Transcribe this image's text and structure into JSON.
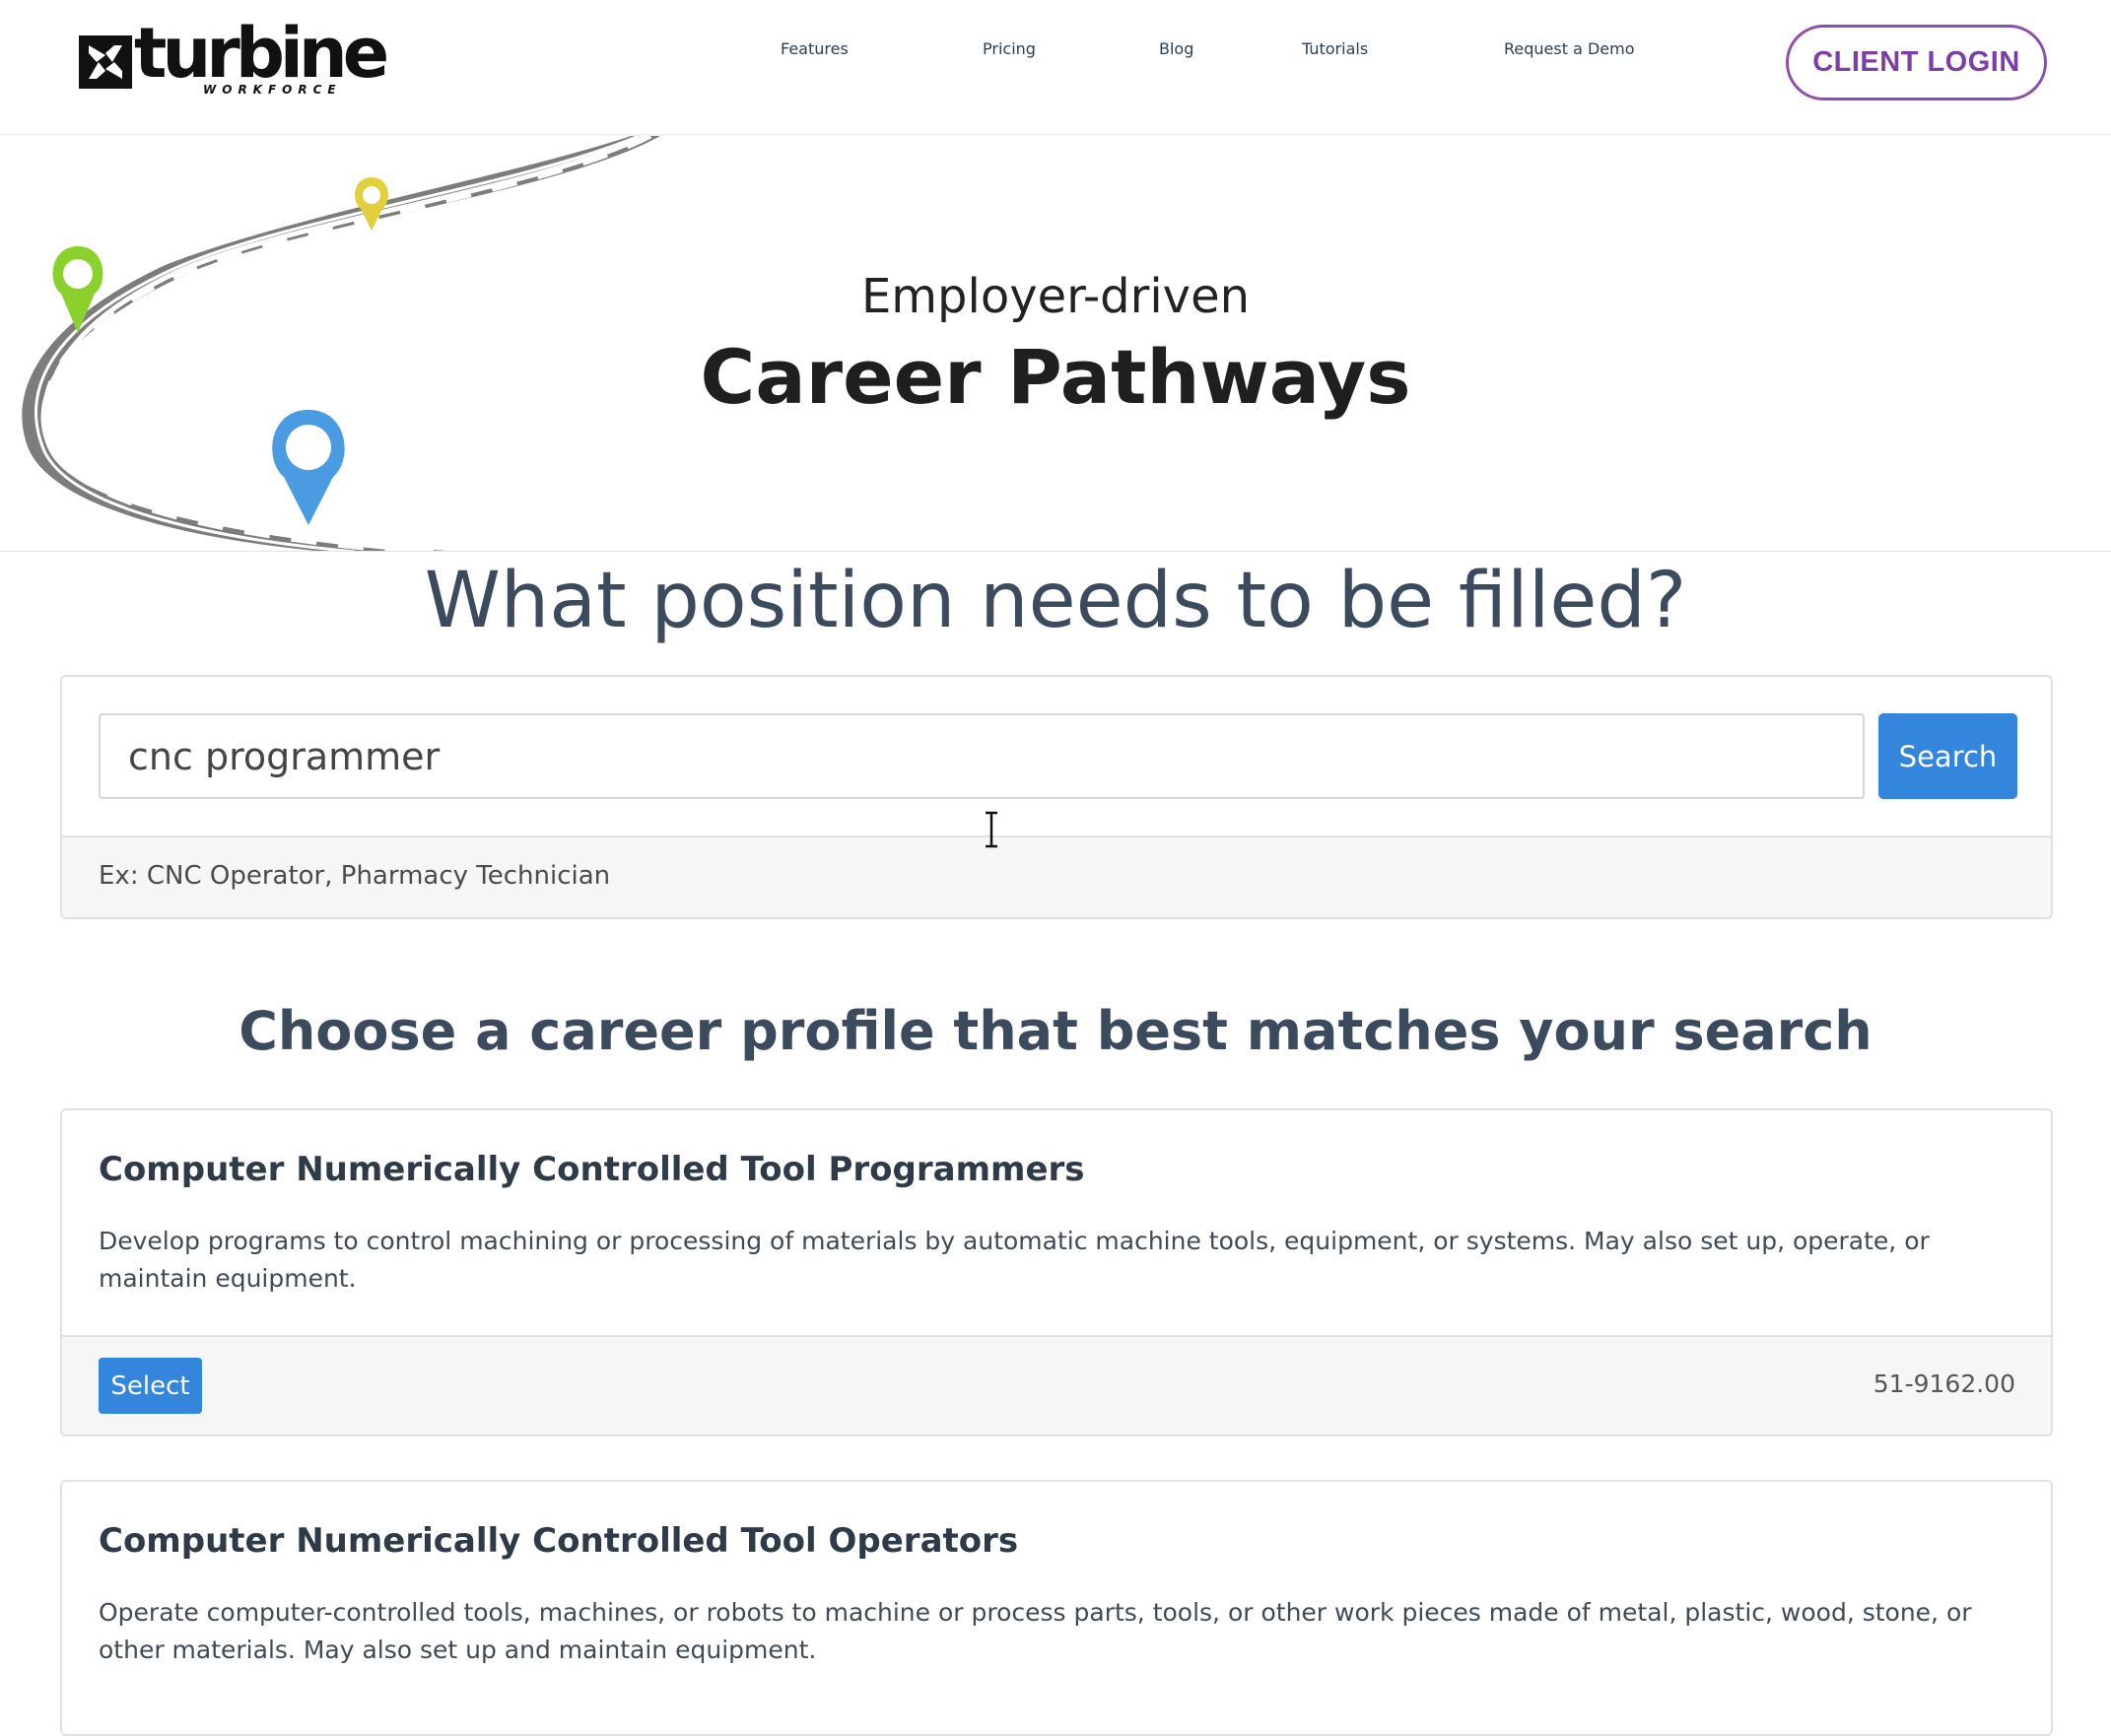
{
  "header": {
    "logo_text": "turbine",
    "logo_sub": "WORKFORCE",
    "nav": [
      {
        "label": "Features"
      },
      {
        "label": "Pricing"
      },
      {
        "label": "Blog"
      },
      {
        "label": "Tutorials"
      },
      {
        "label": "Request a Demo"
      }
    ],
    "login_label": "CLIENT LOGIN",
    "login_color": "#7b3fa3"
  },
  "hero": {
    "subtitle": "Employer-driven",
    "title": "Career Pathways",
    "pin_colors": [
      "#8bd12e",
      "#e2cf3c",
      "#4a9be2"
    ]
  },
  "question": "What position needs to be filled?",
  "search": {
    "value": "cnc programmer",
    "button_label": "Search",
    "hint": "Ex: CNC Operator, Pharmacy Technician",
    "accent": "#3486dd"
  },
  "results": {
    "heading": "Choose a career profile that best matches your search",
    "items": [
      {
        "title": "Computer Numerically Controlled Tool Programmers",
        "description": "Develop programs to control machining or processing of materials by automatic machine tools, equipment, or systems. May also set up, operate, or maintain equipment.",
        "select_label": "Select",
        "code": "51-9162.00"
      },
      {
        "title": "Computer Numerically Controlled Tool Operators",
        "description": "Operate computer-controlled tools, machines, or robots to machine or process parts, tools, or other work pieces made of metal, plastic, wood, stone, or other materials. May also set up and maintain equipment."
      }
    ]
  }
}
